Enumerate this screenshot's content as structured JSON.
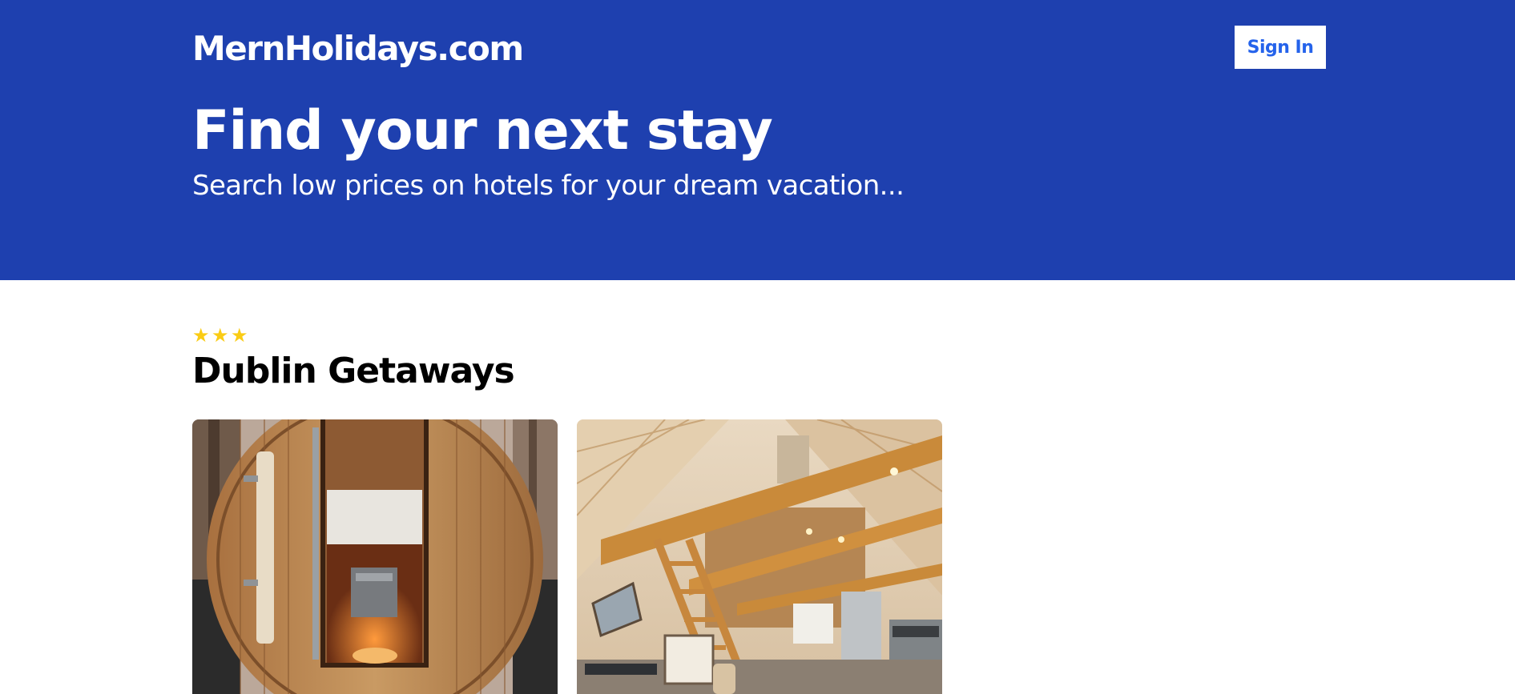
{
  "header": {
    "brand": "MernHolidays.com",
    "sign_in_label": "Sign In"
  },
  "hero": {
    "title": "Find your next stay",
    "subtitle": "Search low prices on hotels for your dream vacation..."
  },
  "listing": {
    "star_rating": 3,
    "title": "Dublin Getaways",
    "images": [
      {
        "subject": "wooden barrel sauna"
      },
      {
        "subject": "A-frame cabin loft interior"
      }
    ]
  },
  "colors": {
    "brand_blue": "#1e40af",
    "button_text": "#2563eb",
    "star": "#facc15"
  }
}
